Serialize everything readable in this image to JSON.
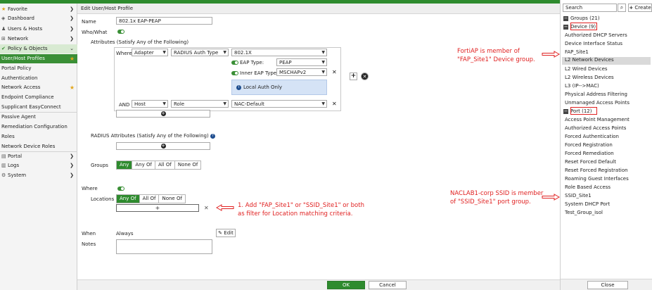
{
  "sidebar": {
    "items": [
      {
        "label": "Favorite",
        "icon": "star-icon"
      },
      {
        "label": "Dashboard",
        "icon": "dashboard-icon"
      },
      {
        "label": "Users & Hosts",
        "icon": "users-icon"
      },
      {
        "label": "Network",
        "icon": "network-icon"
      },
      {
        "label": "Policy & Objects",
        "icon": "policy-icon"
      }
    ],
    "sub_items": [
      "User/Host Profiles",
      "Portal Policy",
      "Authentication",
      "Network Access",
      "Endpoint Compliance",
      "Supplicant EasyConnect",
      "Passive Agent",
      "Remediation Configuration",
      "Roles",
      "Network Device Roles"
    ],
    "bottom_items": [
      {
        "label": "Portal",
        "icon": "portal-icon"
      },
      {
        "label": "Logs",
        "icon": "logs-icon"
      },
      {
        "label": "System",
        "icon": "gear-icon"
      }
    ]
  },
  "form": {
    "page_title": "Edit User/Host Profile",
    "name_label": "Name",
    "name_value": "802.1x EAP-PEAP",
    "who_what_label": "Who/What",
    "attributes_label": "Attributes (Satisfy Any of the Following)",
    "where_word": "Where",
    "and_word": "AND",
    "row1": {
      "field": "Adapter",
      "attr": "RADIUS Auth Type",
      "value": "802.1X"
    },
    "eap_type_label": "EAP Type:",
    "eap_type_value": "PEAP",
    "inner_eap_label": "Inner EAP Type:",
    "inner_eap_value": "MSCHAPv2",
    "local_auth_label": "Local Auth Only",
    "row2": {
      "field": "Host",
      "attr": "Role",
      "value": "NAC-Default"
    },
    "radius_attributes_label": "RADIUS Attributes (Satisfy Any of the Following)",
    "groups_label": "Groups",
    "groups_options": [
      "Any",
      "Any Of",
      "All Of",
      "None Of"
    ],
    "where_label": "Where",
    "locations_label": "Locations",
    "locations_options": [
      "Any Of",
      "All Of",
      "None Of"
    ],
    "when_label": "When",
    "when_value": "Always",
    "edit_label": "Edit",
    "notes_label": "Notes",
    "ok_label": "OK",
    "cancel_label": "Cancel"
  },
  "annotations": {
    "fortiap_line1": "FortiAP is member of",
    "fortiap_line2": "\"FAP_Site1\" Device group.",
    "step1_line1": "1. Add \"FAP_Site1\" or \"SSID_Site1\" or both",
    "step1_line2": "as filter for Location matching criteria.",
    "naclab_line1": "NACLAB1-corp SSID is member",
    "naclab_line2": "of \"SSID_Site1\" port group."
  },
  "right_panel": {
    "search_placeholder": "Search",
    "create_label": "Create",
    "groups_header": "Groups (21)",
    "device_header": "Device (9)",
    "device_items": [
      "Authorized DHCP Servers",
      "Device Interface Status",
      "FAP_Site1",
      "L2 Network Devices",
      "L2 Wired Devices",
      "L2 Wireless Devices",
      "L3 (IP-->MAC)",
      "Physical Address Filtering",
      "Unmanaged Access Points"
    ],
    "port_header": "Port (12)",
    "port_items": [
      "Access Point Management",
      "Authorized Access Points",
      "Forced Authentication",
      "Forced Registration",
      "Forced Remediation",
      "Reset Forced Default",
      "Reset Forced Registration",
      "Roaming Guest Interfaces",
      "Role Based Access",
      "SSID_Site1",
      "System DHCP Port",
      "Test_Group_isol"
    ],
    "close_label": "Close"
  },
  "colors": {
    "accent_green": "#2e8b2e",
    "annotation_red": "#e02020",
    "favorite_star": "#e3a51a"
  }
}
